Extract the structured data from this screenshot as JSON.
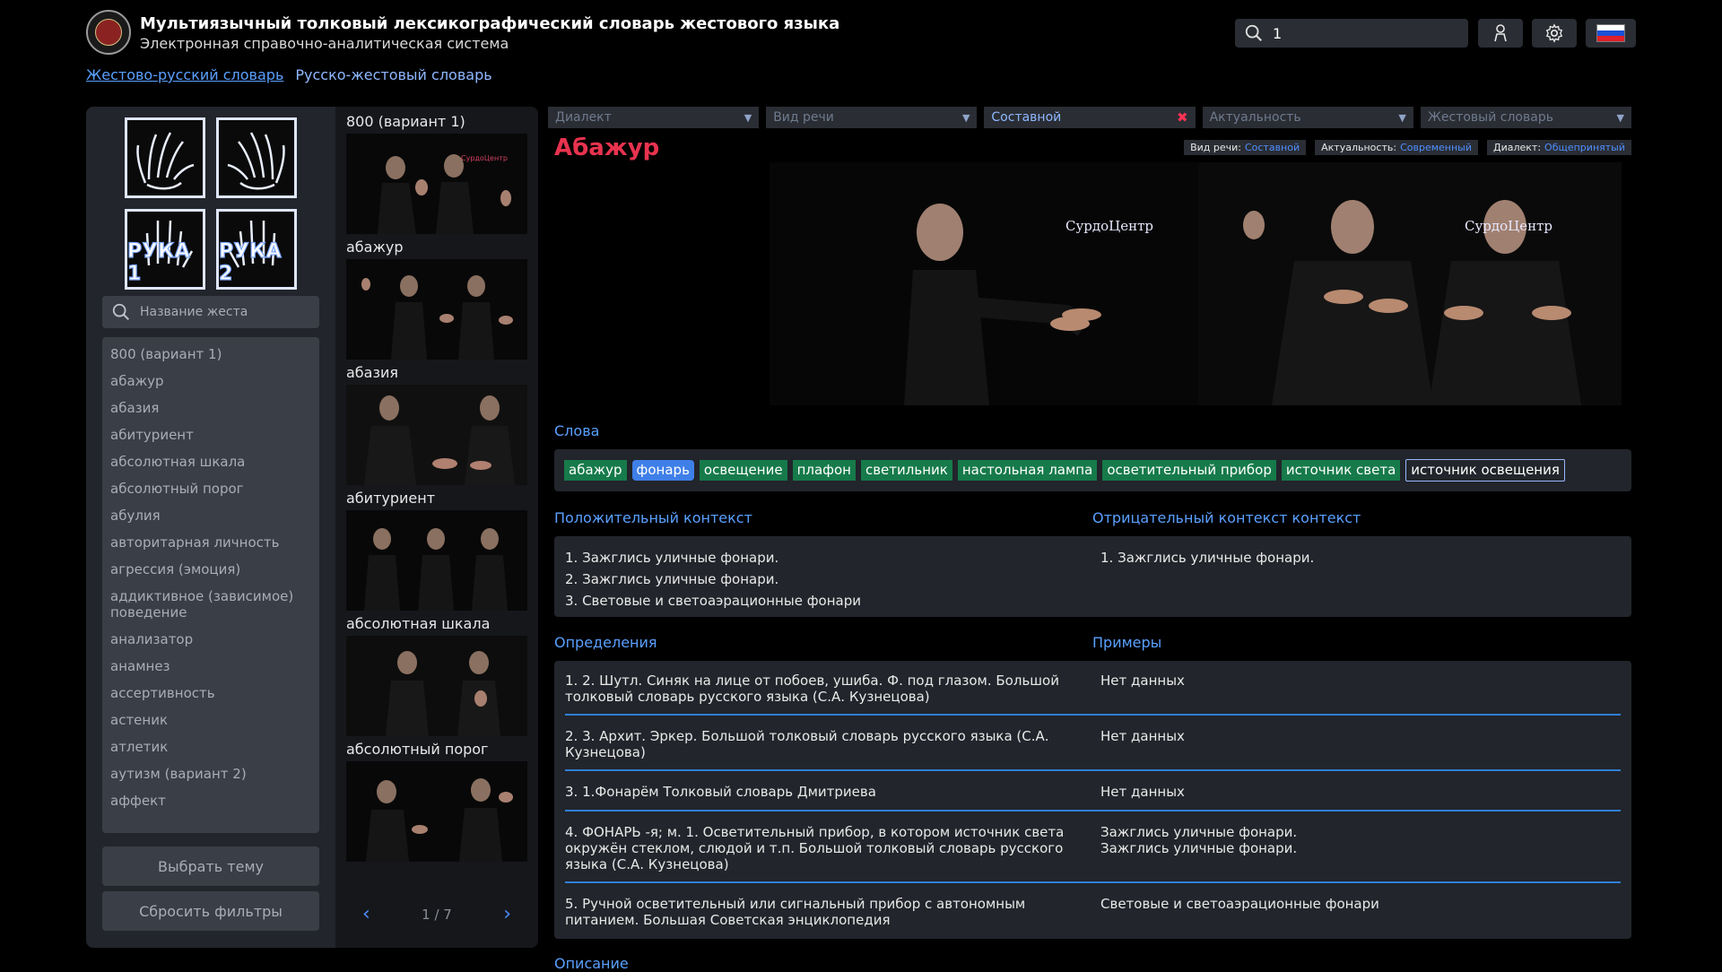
{
  "header": {
    "title": "Мультиязычный толковый лексикографический словарь жестового языка",
    "subtitle": "Электронная справочно-аналитическая система",
    "search_value": "1",
    "icons": {
      "search": "search-icon",
      "user": "user-icon",
      "settings": "gear-icon",
      "language": "russian-flag-icon"
    }
  },
  "tabs": [
    "Жестово-русский словарь",
    "Русско-жестовый словарь"
  ],
  "sidebar": {
    "hands": [
      "РУКА 1",
      "РУКА 2"
    ],
    "search_placeholder": "Название жеста",
    "items": [
      "800 (вариант 1)",
      "абажур",
      "абазия",
      "абитуриент",
      "абсолютная шкала",
      "абсолютный порог",
      "абулия",
      "авторитарная личность",
      "агрессия (эмоция)",
      "аддиктивное (зависимое) поведение",
      "анализатор",
      "анамнез",
      "ассертивность",
      "астеник",
      "атлетик",
      "аутизм (вариант 2)",
      "аффект"
    ],
    "theme_button": "Выбрать тему",
    "reset_button": "Сбросить фильтры"
  },
  "thumbnails": {
    "items": [
      "800 (вариант 1)",
      "абажур",
      "абазия",
      "абитуриент",
      "абсолютная шкала",
      "абсолютный порог"
    ],
    "page": "1 / 7",
    "watermark": "СурдоЦентр"
  },
  "filters": [
    {
      "label": "Диалект",
      "set": false
    },
    {
      "label": "Вид речи",
      "set": false
    },
    {
      "label": "Составной",
      "set": true
    },
    {
      "label": "Актуальность",
      "set": false
    },
    {
      "label": "Жестовый словарь",
      "set": false
    }
  ],
  "entry": {
    "title": "Абажур",
    "meta": [
      {
        "key": "Вид речи:",
        "value": "Составной"
      },
      {
        "key": "Актуальность:",
        "value": "Современный"
      },
      {
        "key": "Диалект:",
        "value": "Общепринятый"
      }
    ],
    "video_watermark_1": "СурдоЦентр",
    "video_watermark_2": "СурдоЦентр"
  },
  "words": {
    "heading": "Слова",
    "items": [
      "абажур",
      "фонарь",
      "освещение",
      "плафон",
      "светильник",
      "настольная лампа",
      "осветительный прибор",
      "источник света",
      "источник освещения"
    ],
    "selected_index": 1,
    "outlined_index": 8
  },
  "context": {
    "positive_heading": "Положительный контекст",
    "negative_heading": "Отрицательный контекст контекст",
    "positive": [
      "1. Зажглись уличные фонари.",
      "2. Зажглись уличные фонари.",
      "3. Световые и светоаэрационные фонари"
    ],
    "negative": [
      "1. Зажглись уличные фонари."
    ]
  },
  "definitions": {
    "heading": "Определения",
    "examples_heading": "Примеры",
    "rows": [
      {
        "def": "1. 2. Шутл. Синяк на лице от побоев, ушиба. Ф. под глазом. Большой толковый словарь русского языка (С.А. Кузнецова)",
        "ex": "Нет данных"
      },
      {
        "def": "2. 3. Архит. Эркер. Большой толковый словарь русского языка (С.А. Кузнецова)",
        "ex": "Нет данных"
      },
      {
        "def": "3. 1.Фонарём Толковый словарь Дмитриева",
        "ex": "Нет данных"
      },
      {
        "def": "4. ФОНАРЬ -я; м. 1. Осветительный прибор, в котором источник света окружён стеклом, слюдой и т.п. Большой толковый словарь русского языка (С.А. Кузнецова)",
        "ex": "Зажглись уличные фонари.\nЗажглись уличные фонари."
      },
      {
        "def": "5. Ручной осветительный или сигнальный прибор с автономным питанием. Большая Советская энциклопедия",
        "ex": "Световые и светоаэрационные фонари"
      }
    ]
  },
  "description_heading": "Описание",
  "colors": {
    "accent": "#5aa0ff",
    "title_red": "#e8334f",
    "chip_green": "#167a4a",
    "chip_selected": "#3f7fe8",
    "panel": "#22252b"
  }
}
